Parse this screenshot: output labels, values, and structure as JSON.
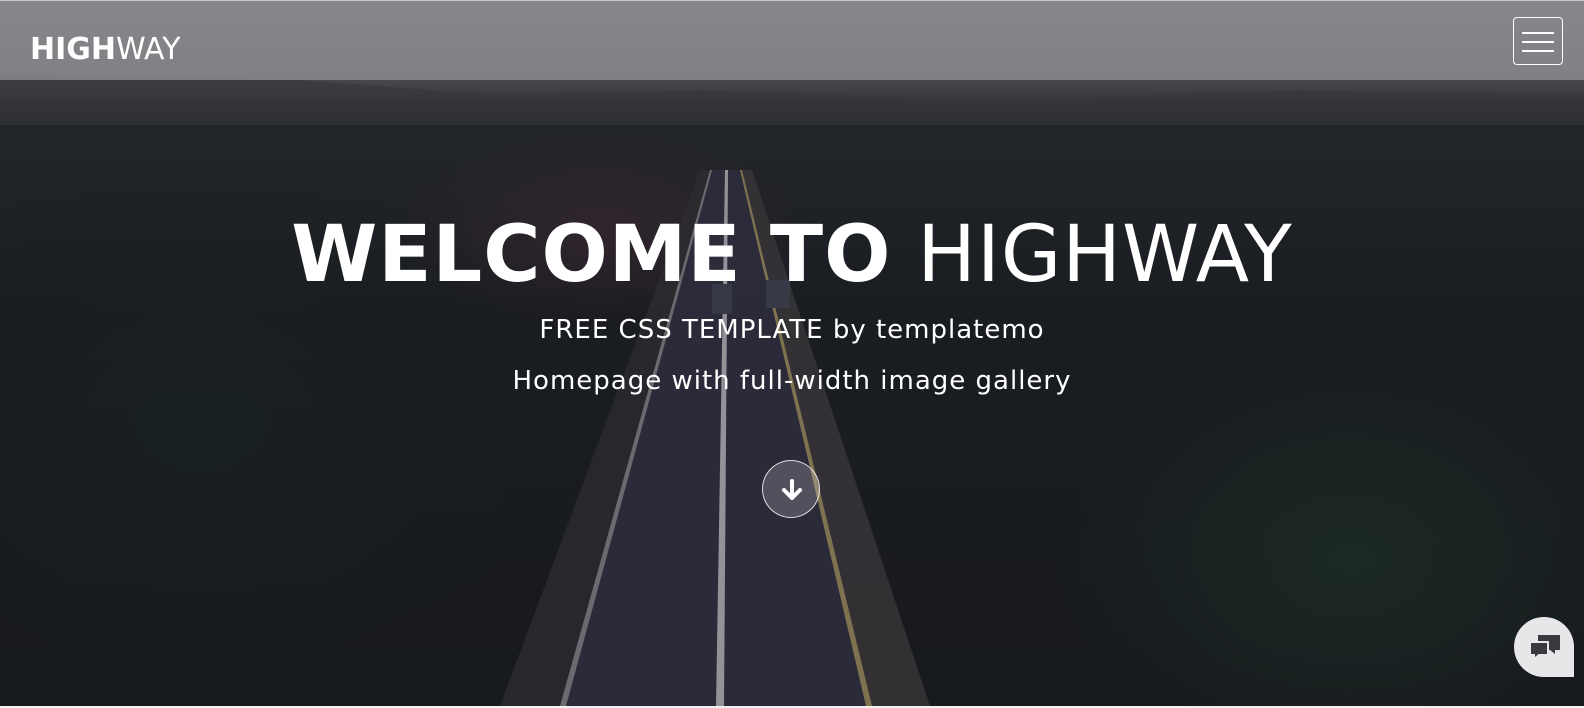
{
  "navbar": {
    "brand_bold": "HIGH",
    "brand_light": "WAY"
  },
  "hero": {
    "headline_bold": "WELCOME TO",
    "headline_light": "HIGHWAY",
    "subtitle": "FREE CSS TEMPLATE by templatemo",
    "tagline": "Homepage with full-width image gallery"
  },
  "icons": {
    "menu": "hamburger-menu-icon",
    "scroll": "arrow-down-icon",
    "chat": "chat-bubbles-icon"
  },
  "colors": {
    "text": "#ffffff",
    "navbar_bg": "#969698",
    "chat_bg": "#e7e7e9",
    "chat_icon": "#3a3a3e"
  }
}
